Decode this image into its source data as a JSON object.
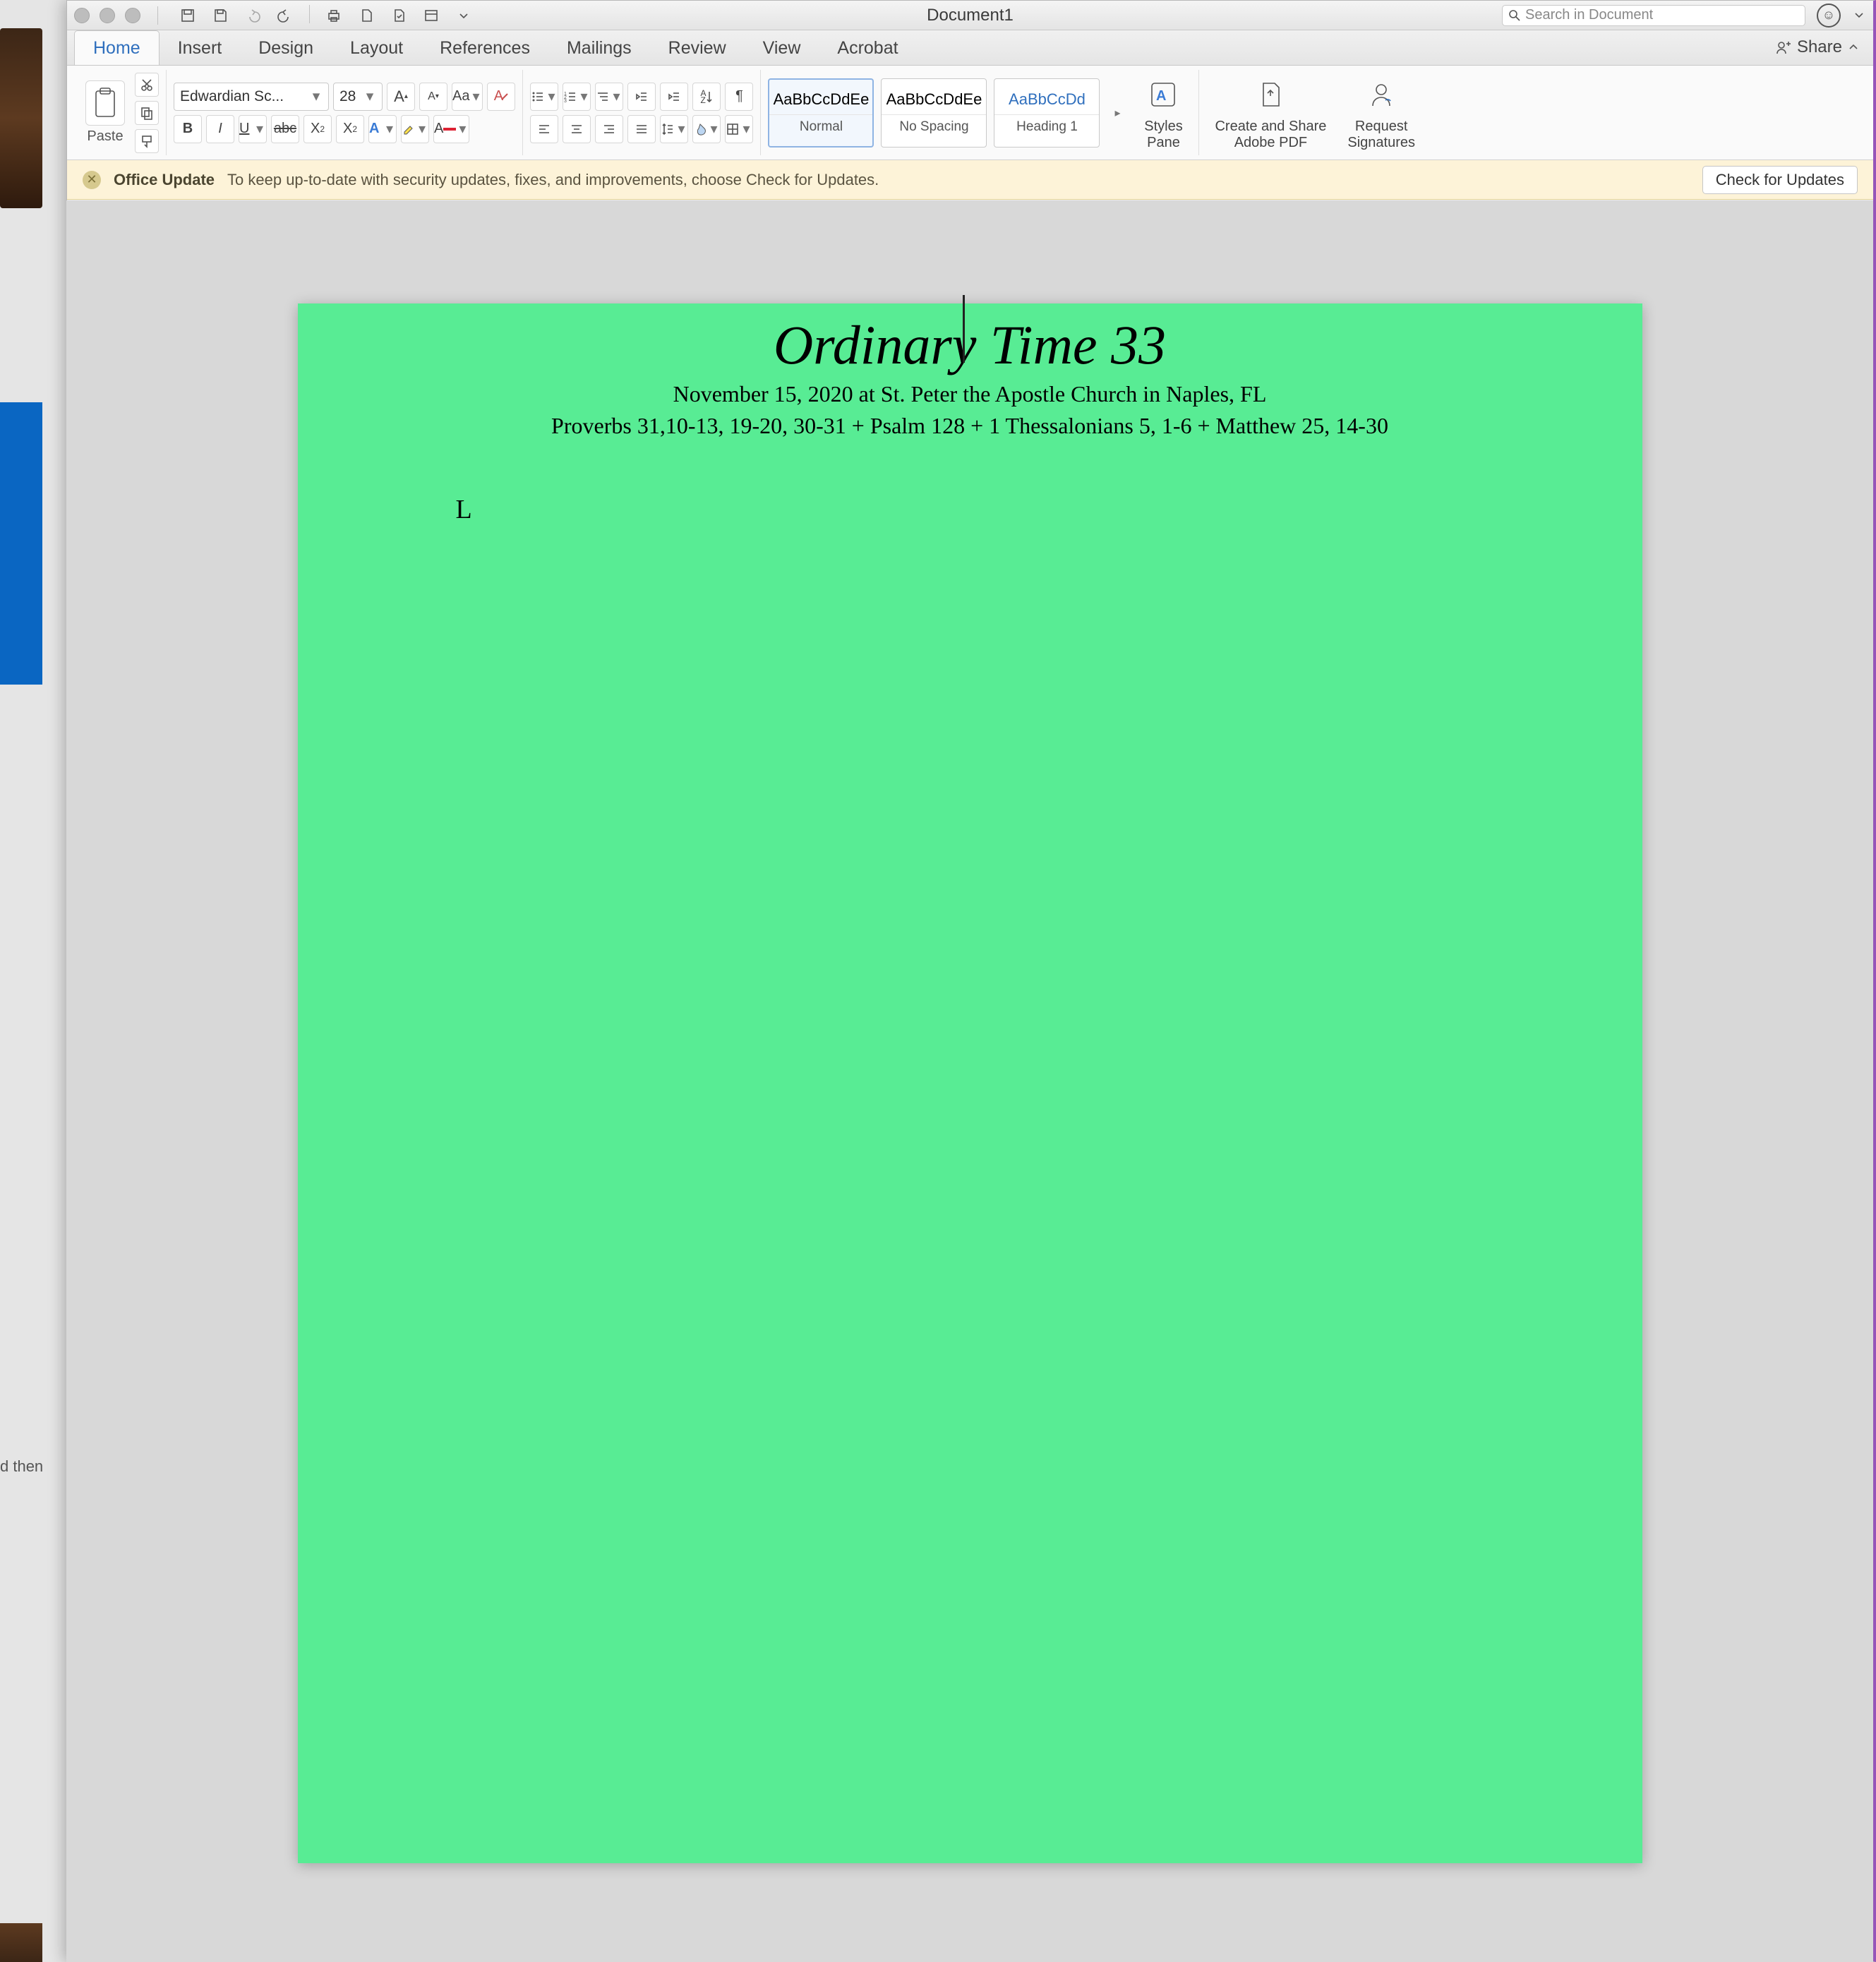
{
  "title": "Document1",
  "search_placeholder": "Search in Document",
  "share_label": "Share",
  "tabs": [
    "Home",
    "Insert",
    "Design",
    "Layout",
    "References",
    "Mailings",
    "Review",
    "View",
    "Acrobat"
  ],
  "active_tab": 0,
  "clipboard": {
    "paste": "Paste"
  },
  "font": {
    "name": "Edwardian Sc...",
    "size": "28"
  },
  "font_buttons": {
    "grow": "A",
    "shrink": "A",
    "case": "Aa",
    "clear": "A"
  },
  "basic": {
    "bold": "B",
    "italic": "I",
    "underline": "U",
    "strike": "abc",
    "sub": "X",
    "sub2": "2",
    "sup": "X",
    "sup2": "2"
  },
  "fontfx": {
    "effects": "A",
    "highlight": "",
    "color": "A"
  },
  "para": {
    "sort": "A Z",
    "pilcrow": "¶"
  },
  "styles": [
    {
      "preview": "AaBbCcDdEe",
      "name": "Normal",
      "sel": true,
      "color": "#333"
    },
    {
      "preview": "AaBbCcDdEe",
      "name": "No Spacing",
      "sel": false,
      "color": "#333"
    },
    {
      "preview": "AaBbCcDd",
      "name": "Heading 1",
      "sel": false,
      "color": "#2f6fbd"
    }
  ],
  "pane": {
    "styles": "Styles\nPane",
    "create": "Create and Share\nAdobe PDF",
    "sign": "Request\nSignatures"
  },
  "notice": {
    "title": "Office Update",
    "msg": "To keep up-to-date with security updates, fixes, and improvements, choose Check for Updates.",
    "btn": "Check for Updates"
  },
  "doc": {
    "title": "Ordinary Time 33",
    "sub": "November 15, 2020 at St. Peter the Apostle Church in Naples, FL",
    "read": "Proverbs 31,10-13, 19-20, 30-31 + Psalm 128 + 1 Thessalonians 5, 1-6 + Matthew 25, 14-30",
    "body": "L"
  },
  "sliver_text": "d then"
}
